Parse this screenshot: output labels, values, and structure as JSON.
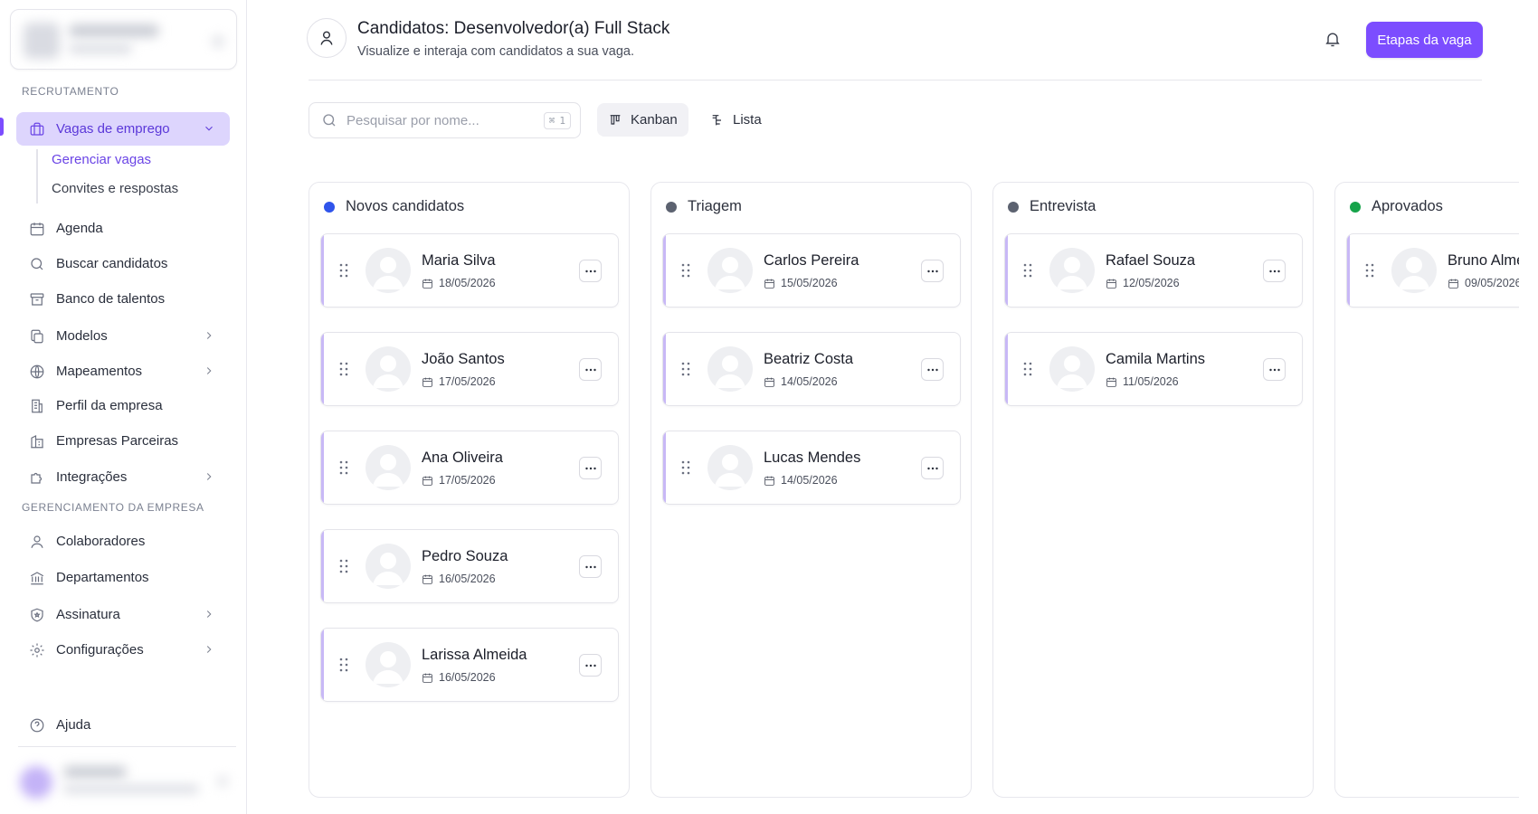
{
  "sidebar": {
    "sections": {
      "recruitment": "RECRUTAMENTO",
      "company": "GERENCIAMENTO DA EMPRESA"
    },
    "items": [
      {
        "label": "Vagas de emprego",
        "icon": "briefcase-icon",
        "active": true,
        "expandable": true
      },
      {
        "label": "Agenda",
        "icon": "calendar-icon"
      },
      {
        "label": "Buscar candidatos",
        "icon": "search-icon"
      },
      {
        "label": "Banco de talentos",
        "icon": "archive-icon"
      },
      {
        "label": "Modelos",
        "icon": "copy-icon",
        "expandable": true
      },
      {
        "label": "Mapeamentos",
        "icon": "globe-icon",
        "expandable": true
      },
      {
        "label": "Perfil da empresa",
        "icon": "building-icon"
      },
      {
        "label": "Empresas Parceiras",
        "icon": "buildings-icon"
      },
      {
        "label": "Integrações",
        "icon": "puzzle-icon",
        "expandable": true
      },
      {
        "label": "Colaboradores",
        "icon": "user-icon"
      },
      {
        "label": "Departamentos",
        "icon": "landmark-icon"
      },
      {
        "label": "Assinatura",
        "icon": "shield-icon",
        "expandable": true
      },
      {
        "label": "Configurações",
        "icon": "gear-icon",
        "expandable": true
      },
      {
        "label": "Ajuda",
        "icon": "help-circle-icon"
      }
    ],
    "subitems": [
      {
        "label": "Gerenciar vagas",
        "active": true
      },
      {
        "label": "Convites e respostas"
      }
    ]
  },
  "header": {
    "title": "Candidatos: Desenvolvedor(a) Full Stack",
    "subtitle": "Visualize e interaja com candidatos a sua vaga.",
    "cta_label": "Etapas da vaga"
  },
  "toolbar": {
    "search_placeholder": "Pesquisar por nome...",
    "shortcut_key": "1",
    "views": [
      {
        "label": "Kanban",
        "active": true
      },
      {
        "label": "Lista"
      }
    ]
  },
  "colors": {
    "accent": "#7c4dff",
    "stage_blue": "#2f54eb",
    "stage_gray": "#5c6270",
    "stage_green": "#16a34a"
  },
  "columns": [
    {
      "title": "Novos candidatos",
      "dot_color": "#2f54eb",
      "cards": [
        {
          "name": "Maria Silva",
          "date": "18/05/2026"
        },
        {
          "name": "João Santos",
          "date": "17/05/2026"
        },
        {
          "name": "Ana Oliveira",
          "date": "17/05/2026"
        },
        {
          "name": "Pedro Souza",
          "date": "16/05/2026"
        },
        {
          "name": "Larissa Almeida",
          "date": "16/05/2026"
        }
      ]
    },
    {
      "title": "Triagem",
      "dot_color": "#5c6270",
      "cards": [
        {
          "name": "Carlos Pereira",
          "date": "15/05/2026"
        },
        {
          "name": "Beatriz Costa",
          "date": "14/05/2026"
        },
        {
          "name": "Lucas Mendes",
          "date": "14/05/2026"
        }
      ]
    },
    {
      "title": "Entrevista",
      "dot_color": "#5c6270",
      "cards": [
        {
          "name": "Rafael Souza",
          "date": "12/05/2026"
        },
        {
          "name": "Camila Martins",
          "date": "11/05/2026"
        }
      ]
    },
    {
      "title": "Aprovados",
      "dot_color": "#16a34a",
      "cards": [
        {
          "name": "Bruno Almeida",
          "date": "09/05/2026"
        }
      ]
    }
  ]
}
